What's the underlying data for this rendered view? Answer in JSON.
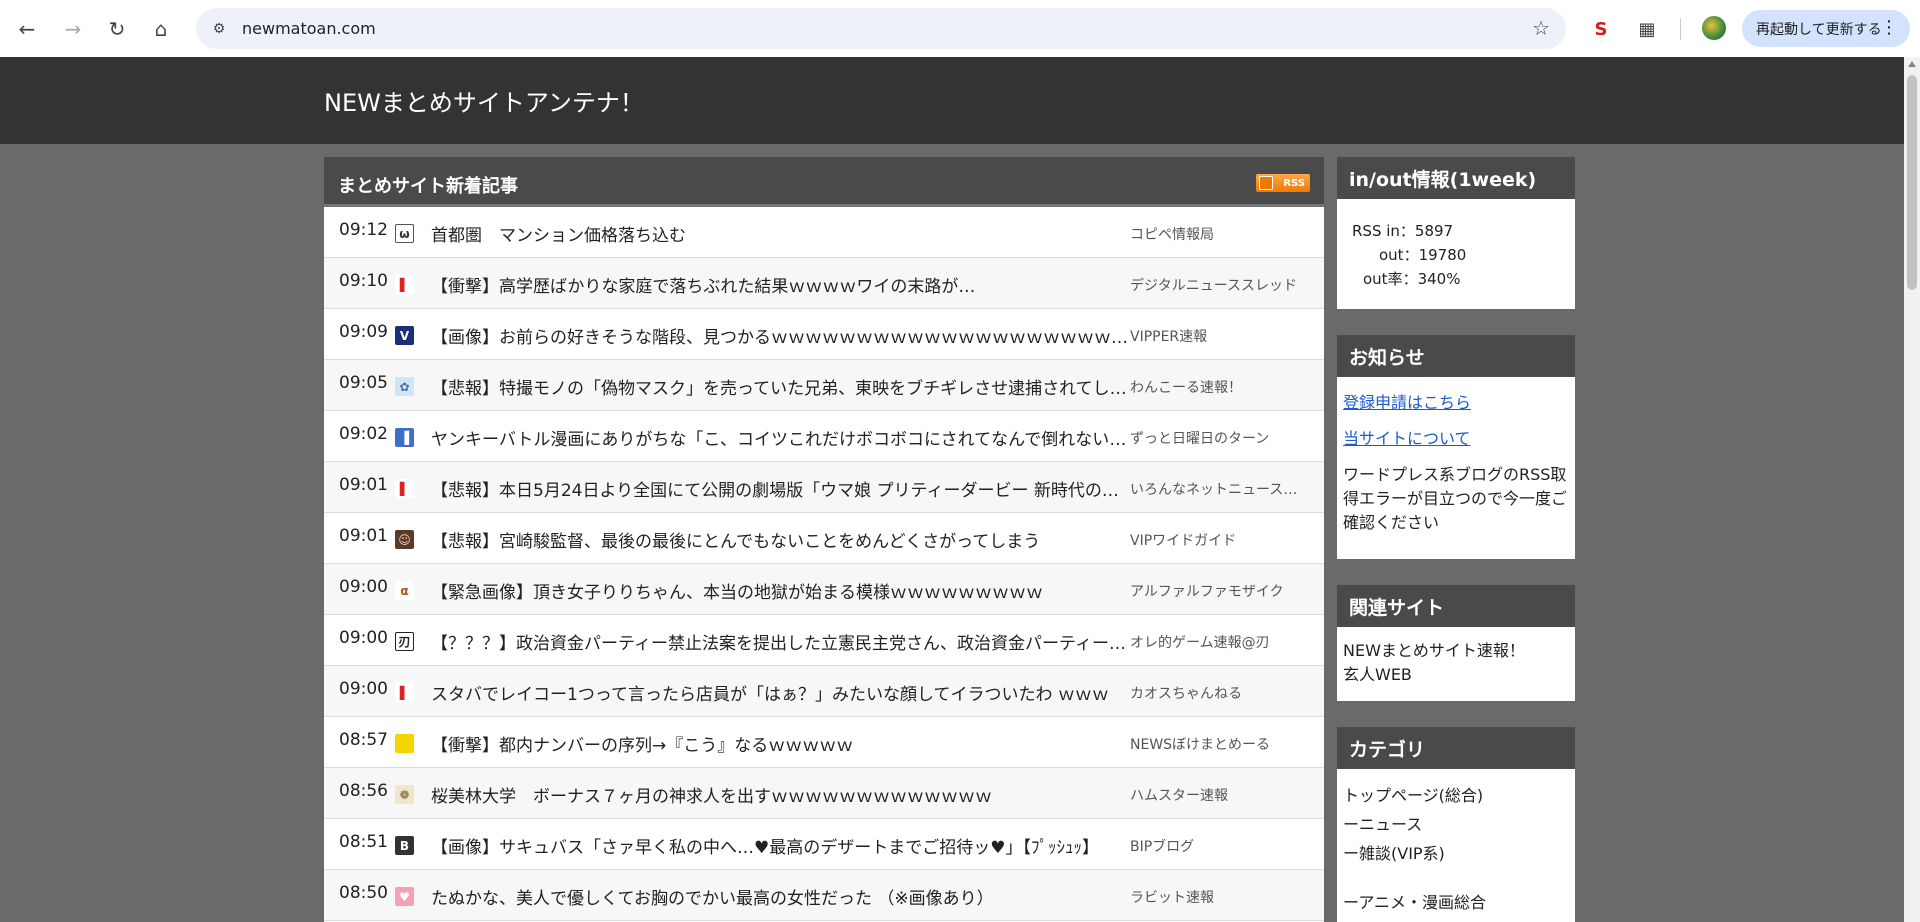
{
  "browser": {
    "url": "newmatoan.com",
    "restart_label": "再起動して更新する"
  },
  "site": {
    "title": "NEWまとめサイトアンテナ！"
  },
  "main": {
    "title": "まとめサイト新着記事",
    "rss_label": "RSS",
    "articles": [
      {
        "time": "09:12",
        "icon": "face-icon",
        "headline": "首都圏　マンション価格落ち込む",
        "source": "コピペ情報局"
      },
      {
        "time": "09:10",
        "icon": "red-box-icon",
        "headline": "【衝撃】高学歴ばかりな家庭で落ちぶれた結果ｗｗｗｗワイの末路が…",
        "source": "デジタルニューススレッド"
      },
      {
        "time": "09:09",
        "icon": "v-icon",
        "headline": "【画像】お前らの好きそうな階段、見つかるｗｗｗｗｗｗｗｗｗｗｗｗｗｗｗｗｗｗｗｗｗｗ",
        "source": "VIPPER速報"
      },
      {
        "time": "09:05",
        "icon": "anime-icon",
        "headline": "【悲報】特撮モノの「偽物マスク」を売っていた兄弟、東映をブチギレさせ逮捕されてしまう",
        "source": "わんこーる速報！"
      },
      {
        "time": "09:02",
        "icon": "blue-box-icon",
        "headline": "ヤンキーバトル漫画にありがちな「こ、コイツこれだけボコボコにされてなんで倒れないんだ…」",
        "source": "ずっと日曜日のターン"
      },
      {
        "time": "09:01",
        "icon": "red-box-icon",
        "headline": "【悲報】本日5月24日より全国にて公開の劇場版「ウマ娘 プリティーダービー 新時代の扉」",
        "source": "いろんなネットニュースまとめ"
      },
      {
        "time": "09:01",
        "icon": "portrait-icon",
        "headline": "【悲報】宮崎駿監督、最後の最後にとんでもないことをめんどくさがってしまう",
        "source": "VIPワイドガイド"
      },
      {
        "time": "09:00",
        "icon": "alpha-icon",
        "headline": "【緊急画像】頂き女子りりちゃん、本当の地獄が始まる模様ｗｗｗｗｗｗｗｗｗ",
        "source": "アルファルファモザイク"
      },
      {
        "time": "09:00",
        "icon": "blade-icon",
        "headline": "【？？？】政治資金パーティー禁止法案を提出した立憲民主党さん、政治資金パーティーを開催",
        "source": "オレ的ゲーム速報@刃"
      },
      {
        "time": "09:00",
        "icon": "red-box-icon",
        "headline": "スタバでレイコー1つって言ったら店員が「はぁ？」みたいな顔してイラついたわ ｗｗｗ",
        "source": "カオスちゃんねる"
      },
      {
        "time": "08:57",
        "icon": "yellow-square-icon",
        "headline": "【衝撃】都内ナンバーの序列→『こう』なるｗｗｗｗｗ",
        "source": "NEWSぼけまとめーる"
      },
      {
        "time": "08:56",
        "icon": "hamster-icon",
        "headline": "桜美林大学　ボーナス７ヶ月の神求人を出すｗｗｗｗｗｗｗｗｗｗｗｗｗ",
        "source": "ハムスター速報"
      },
      {
        "time": "08:51",
        "icon": "b-icon",
        "headline": "【画像】サキュバス「さァ早く私の中へ…♥最高のデザートまでご招待ッ♥」【ﾌﾟｯｼｭｯ】",
        "source": "BIPブログ"
      },
      {
        "time": "08:50",
        "icon": "rabbit-icon",
        "headline": "たぬかな、美人で優しくてお胸のでかい最高の女性だった （※画像あり）",
        "source": "ラビット速報"
      }
    ]
  },
  "sidebar": {
    "inout": {
      "title": "in/out情報(1week)",
      "rss_in": "RSS in：5897",
      "out": "out：19780",
      "out_rate": "out率：340%"
    },
    "notice": {
      "title": "お知らせ",
      "link1": "登録申請はこちら",
      "link2": "当サイトについて",
      "text": "ワードプレス系ブログのRSS取得エラーが目立つので今一度ご確認ください"
    },
    "related": {
      "title": "関連サイト",
      "items": [
        "NEWまとめサイト速報！",
        "玄人WEB"
      ]
    },
    "category": {
      "title": "カテゴリ",
      "items": [
        "トップページ(総合)",
        "ーニュース",
        "ー雑談(VIP系)",
        "",
        "ーアニメ・漫画総合"
      ]
    }
  }
}
